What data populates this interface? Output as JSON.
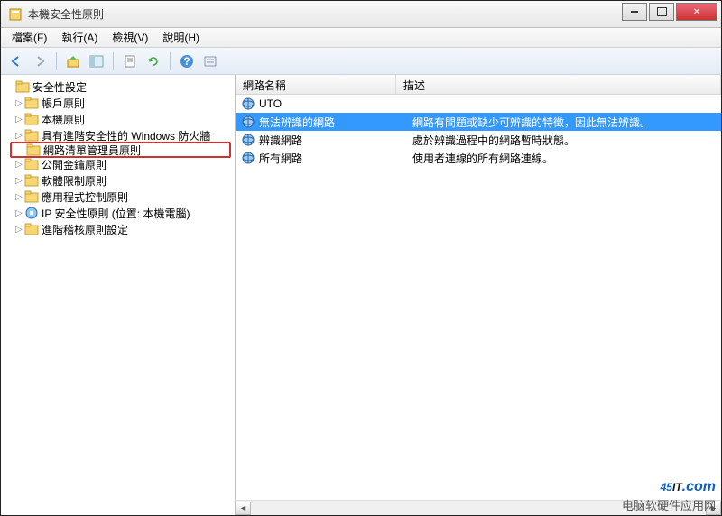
{
  "window": {
    "title": "本機安全性原則"
  },
  "menu": {
    "file": "檔案(F)",
    "action": "執行(A)",
    "view": "檢視(V)",
    "help": "說明(H)"
  },
  "tree": {
    "root": "安全性設定",
    "items": [
      "帳戶原則",
      "本機原則",
      "具有進階安全性的 Windows 防火牆",
      "網路清單管理員原則",
      "公開金鑰原則",
      "軟體限制原則",
      "應用程式控制原則",
      "IP 安全性原則 (位置: 本機電腦)",
      "進階稽核原則設定"
    ],
    "highlighted_index": 3
  },
  "columns": {
    "name": "網路名稱",
    "desc": "描述"
  },
  "rows": [
    {
      "name": "UTO",
      "desc": "",
      "selected": false
    },
    {
      "name": "無法辨識的網路",
      "desc": "網路有問題或缺少可辨識的特徵，因此無法辨識。",
      "selected": true
    },
    {
      "name": "辨識網路",
      "desc": "處於辨識過程中的網路暫時狀態。",
      "selected": false
    },
    {
      "name": "所有網路",
      "desc": "使用者連線的所有網路連線。",
      "selected": false
    }
  ],
  "watermark": {
    "brand_blue": "45",
    "brand_black": "IT",
    "dot": ".com",
    "sub": "电脑软硬件应用网"
  }
}
